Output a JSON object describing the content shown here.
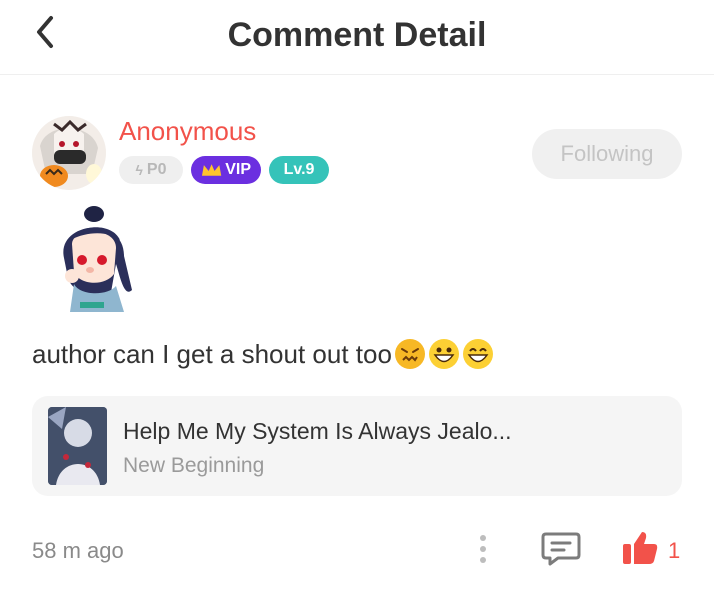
{
  "header": {
    "title": "Comment Detail"
  },
  "user": {
    "name": "Anonymous",
    "badges": {
      "p": "P0",
      "vip": "VIP",
      "level": "Lv.9"
    },
    "follow_label": "Following"
  },
  "comment": {
    "text": "author can I get a shout out too"
  },
  "book": {
    "title": "Help Me My System Is Always Jealo...",
    "subtitle": "New Beginning"
  },
  "footer": {
    "time": "58 m ago",
    "likes": "1"
  },
  "colors": {
    "accent": "#f2524a",
    "vip": "#6b2fe0",
    "level": "#35c3b9"
  }
}
